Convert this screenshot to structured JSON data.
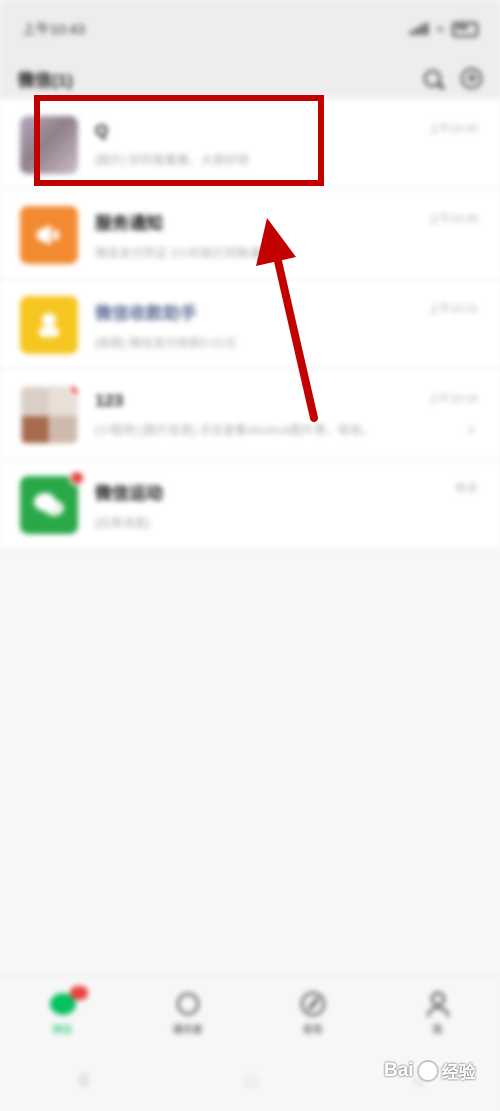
{
  "status_bar": {
    "time": "上午10:43"
  },
  "header": {
    "title": "微信(1)"
  },
  "chats": [
    {
      "name": "Q",
      "preview": "[图片] 好的我看看，大家好呀",
      "time": "上午10:40",
      "muted": false,
      "unread_dot": false
    },
    {
      "name": "服务通知",
      "preview": "微信支付凭证 2小时前已到账通知",
      "time": "上午10:28",
      "muted": false,
      "unread_dot": false
    },
    {
      "name": "微信收款助手",
      "preview": "[收款] 微信支付收款0.01元",
      "time": "上午10:21",
      "muted": false,
      "unread_dot": false
    },
    {
      "name": "123",
      "preview": "[小程序] [图片信息] 点击查看shortcut图片等，收收。",
      "time": "上午10:16",
      "muted": true,
      "mute_icon": "bell-off-icon",
      "unread_dot": true
    },
    {
      "name": "微信运动",
      "preview": "[应用消息]",
      "time": "昨天",
      "muted": false,
      "unread_dot": true
    }
  ],
  "tabs": [
    {
      "label": "微信",
      "icon": "chat-icon",
      "active": true,
      "badge": true
    },
    {
      "label": "通讯录",
      "icon": "contacts-icon",
      "active": false
    },
    {
      "label": "发现",
      "icon": "compass-icon",
      "active": false
    },
    {
      "label": "我",
      "icon": "person-icon",
      "active": false
    }
  ],
  "annotation": {
    "color": "#c20000"
  },
  "watermark": {
    "brand": "Bai",
    "suffix": "经验"
  },
  "colors": {
    "accent_green": "#07c160",
    "badge_red": "#e64340",
    "service_orange": "#f28a32",
    "payment_yellow": "#f6c620",
    "sport_green": "#2aa848"
  }
}
